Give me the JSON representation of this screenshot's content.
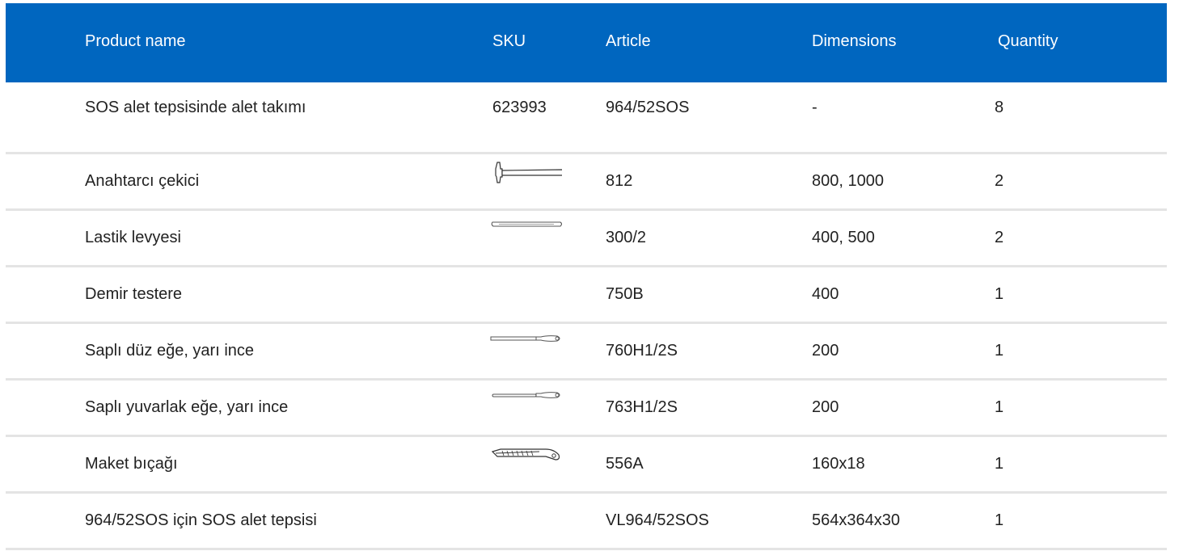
{
  "header": {
    "product_name": "Product name",
    "sku": "SKU",
    "article": "Article",
    "dimensions": "Dimensions",
    "quantity": "Quantity"
  },
  "colors": {
    "header_bg": "#0066bf",
    "header_text": "#ffffff",
    "row_divider": "#e4e4e4"
  },
  "rows": [
    {
      "name": "SOS alet tepsisinde alet takımı",
      "sku": "623993",
      "article": "964/52SOS",
      "dimensions": "-",
      "quantity": "8",
      "image": "none"
    },
    {
      "name": "Anahtarcı çekici",
      "sku": "",
      "article": "812",
      "dimensions": "800, 1000",
      "quantity": "2",
      "image": "hammer-icon"
    },
    {
      "name": "Lastik levyesi",
      "sku": "",
      "article": "300/2",
      "dimensions": "400, 500",
      "quantity": "2",
      "image": "tyre-lever-icon"
    },
    {
      "name": "Demir testere",
      "sku": "",
      "article": "750B",
      "dimensions": "400",
      "quantity": "1",
      "image": "none"
    },
    {
      "name": "Saplı düz eğe, yarı ince",
      "sku": "",
      "article": "760H1/2S",
      "dimensions": "200",
      "quantity": "1",
      "image": "flat-file-icon"
    },
    {
      "name": "Saplı yuvarlak eğe, yarı ince",
      "sku": "",
      "article": "763H1/2S",
      "dimensions": "200",
      "quantity": "1",
      "image": "round-file-icon"
    },
    {
      "name": "Maket bıçağı",
      "sku": "",
      "article": "556A",
      "dimensions": "160x18",
      "quantity": "1",
      "image": "utility-knife-icon"
    },
    {
      "name": "964/52SOS için SOS alet tepsisi",
      "sku": "",
      "article": "VL964/52SOS",
      "dimensions": "564x364x30",
      "quantity": "1",
      "image": "none"
    }
  ]
}
